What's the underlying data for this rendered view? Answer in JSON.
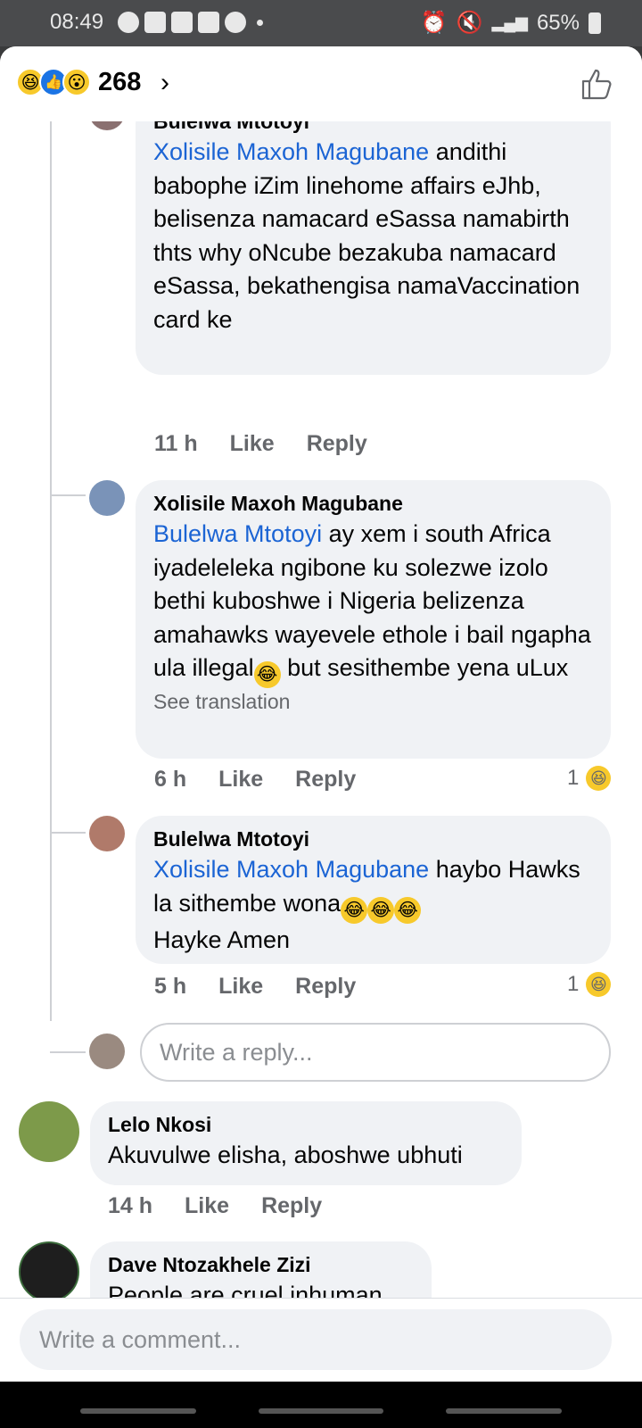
{
  "status_bar": {
    "time": "08:49",
    "battery": "65%"
  },
  "reactions": {
    "count": "268"
  },
  "comments": [
    {
      "author": "Bulelwa Mtotoyi",
      "mention": "Xolisile Maxoh Magubane",
      "text": " andithi babophe iZim linehome affairs eJhb, belisenza namacard eSassa namabirth thts why oNcube bezakuba namacard eSassa, bekathengisa namaVaccination card ke",
      "time": "11 h",
      "like": "Like",
      "reply": "Reply"
    },
    {
      "author": "Xolisile Maxoh Magubane",
      "mention": "Bulelwa Mtotoyi",
      "text_a": " ay xem i south Africa iyadeleleka ngibone ku solezwe izolo bethi kuboshwe i Nigeria belizenza amahawks wayevele ethole i bail ngapha ula illegal",
      "text_b": " but sesithembe yena uLux",
      "see_translation": "See translation",
      "time": "6 h",
      "like": "Like",
      "reply": "Reply",
      "reaction_count": "1"
    },
    {
      "author": "Bulelwa Mtotoyi",
      "mention": "Xolisile Maxoh Magubane",
      "text_a": " haybo Hawks la sithembe wona",
      "text_b": "Hayke Amen",
      "time": "5 h",
      "like": "Like",
      "reply": "Reply",
      "reaction_count": "1"
    },
    {
      "author": "Lelo Nkosi",
      "text": "Akuvulwe elisha, aboshwe ubhuti",
      "time": "14 h",
      "like": "Like",
      "reply": "Reply"
    },
    {
      "author": "Dave Ntozakhele Zizi",
      "text": "People are cruel inhuman"
    }
  ],
  "reply_input": {
    "placeholder": "Write a reply..."
  },
  "comment_input": {
    "placeholder": "Write a comment..."
  },
  "colors": {
    "mention": "#1b64d4",
    "bubble": "#f0f2f5",
    "meta": "#65676b"
  }
}
